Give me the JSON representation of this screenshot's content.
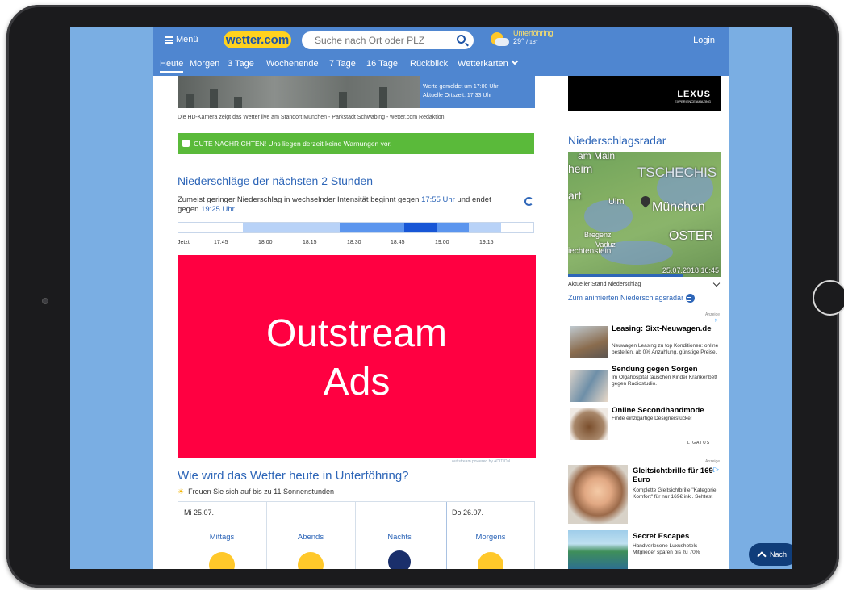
{
  "header": {
    "menu_label": "Menü",
    "logo": "wetter.com",
    "search_placeholder": "Suche nach Ort oder PLZ",
    "location_name": "Unterföhring",
    "location_temp": "29°",
    "location_temp_low": "/ 18°",
    "login_label": "Login"
  },
  "nav": {
    "items": [
      "Heute",
      "Morgen",
      "3 Tage",
      "Wochenende",
      "7 Tage",
      "16 Tage",
      "Rückblick",
      "Wetterkarten"
    ]
  },
  "webcam": {
    "reported": "Werte gemeldet um 17:00 Uhr",
    "local_time": "Aktuelle Ortszeit: 17:33 Uhr",
    "caption": "Die HD-Kamera zeigt das Wetter live am Standort München - Parkstadt Schwabing - wetter.com Redaktion"
  },
  "notice": "GUTE NACHRICHTEN! Uns liegen derzeit keine Warnungen vor.",
  "precip": {
    "title": "Niederschläge der nächsten 2 Stunden",
    "text_a": "Zumeist geringer Niederschlag in wechselnder Intensität beginnt gegen",
    "time_start": "17:55 Uhr",
    "text_b": "und endet gegen",
    "time_end": "19:25 Uhr",
    "times": [
      "Jetzt",
      "17:45",
      "18:00",
      "18:15",
      "18:30",
      "18:45",
      "19:00",
      "19:15"
    ]
  },
  "ad": {
    "line1": "Outstream",
    "line2": "Ads",
    "footer": "out.stream powered by ADITION"
  },
  "today": {
    "title": "Wie wird das Wetter heute in Unterföhring?",
    "sunshine": "Freuen Sie sich auf bis zu 11 Sonnenstunden",
    "date1": "Mi 25.07.",
    "date2": "Do 26.07.",
    "periods": [
      "Mittags",
      "Abends",
      "Nachts",
      "Morgens"
    ]
  },
  "sidebar": {
    "lexus": "LEXUS",
    "lexus_tag": "EXPERIENCE AMAZING",
    "radar_title": "Niederschlagsradar",
    "radar_cities": [
      "am Main",
      "heim",
      "TSCHECHIS",
      "art",
      "Ulm",
      "München",
      "Bregenz",
      "Vaduz",
      "iechtenstein",
      "OSTER"
    ],
    "radar_timestamp": "25.07.2018 16:45",
    "radar_caption": "Aktueller Stand Niederschlag",
    "radar_link": "Zum animierten Niederschlagsradar",
    "ad_label": "Anzeige",
    "ads": [
      {
        "title": "Leasing: Sixt-Neuwagen.de",
        "desc": "Neuwagen Leasing zu top Konditionen: online bestellen, ab 0% Anzahlung, günstige Preise."
      },
      {
        "title": "Sendung gegen Sorgen",
        "desc": "Im Olgahospital tauschen Kinder Krankenbett gegen Radiostudio."
      },
      {
        "title": "Online Secondhandmode",
        "desc": "Finde einzigartige Designerstücke!"
      }
    ],
    "ligatus": "LIGATUS",
    "ads2": [
      {
        "title": "Gleitsichtbrille für 169 Euro",
        "desc": "Komplette Gleitsichtbrille \"Kategorie Komfort\" für nur 169€ inkl. Sehtest"
      },
      {
        "title": "Secret Escapes",
        "desc": "Handverlesene Luxushotels Mitglieder sparen bis zu 70%"
      }
    ]
  },
  "back_button": "Nach",
  "colors": {
    "brand_blue": "#4f86d0",
    "logo_yellow": "#ffd21e",
    "ad_red": "#ff0041",
    "notice_green": "#5aba3a",
    "side_blue": "#7aaee3"
  },
  "rain_intensity": [
    0,
    0,
    1,
    1,
    1,
    2,
    2,
    3,
    2,
    1,
    0
  ]
}
